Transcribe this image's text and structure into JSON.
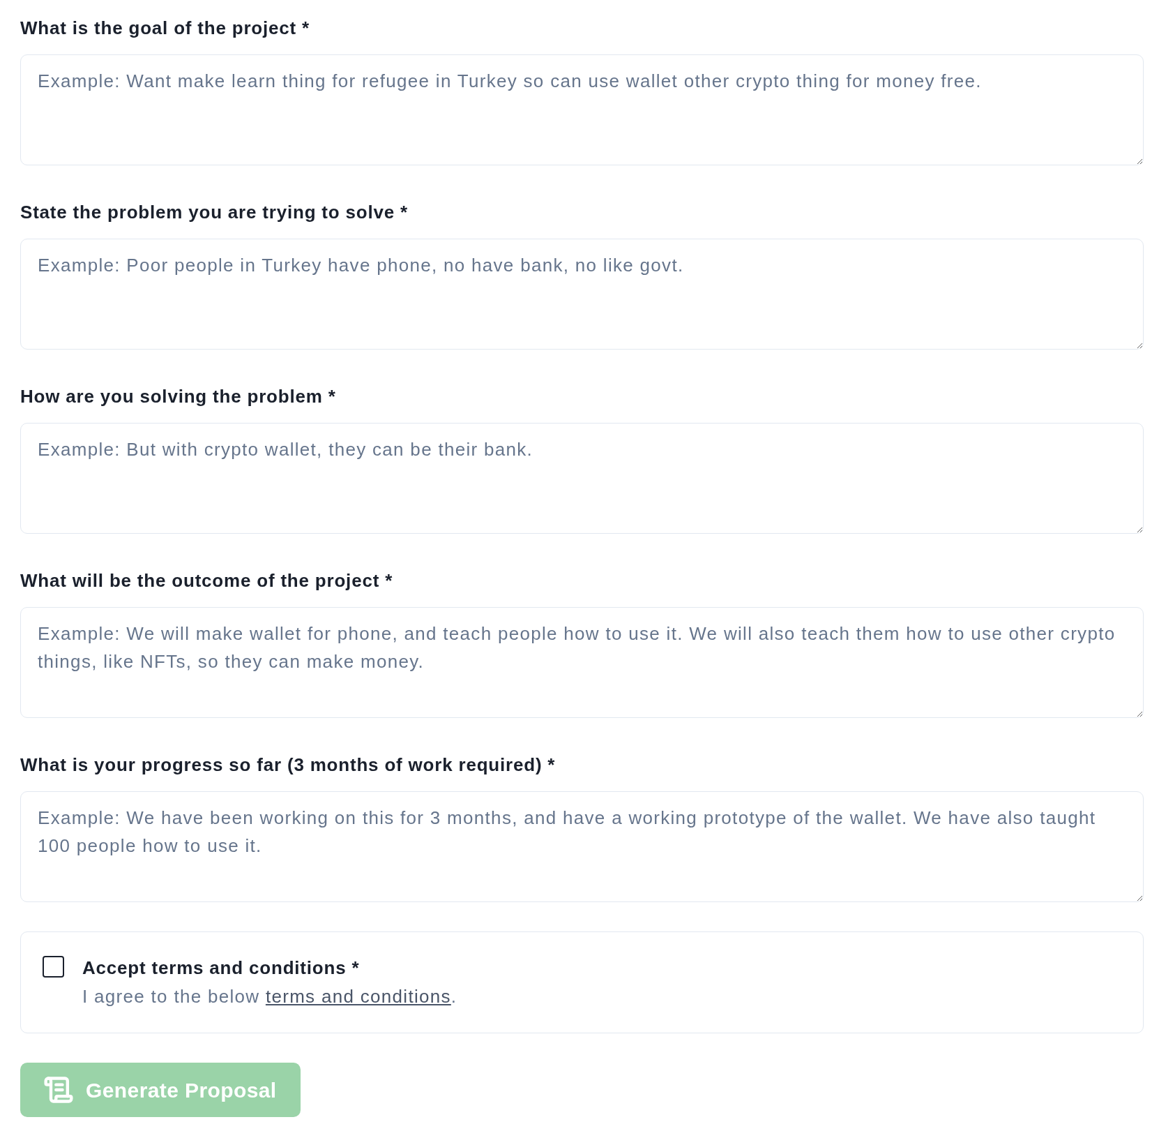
{
  "fields": [
    {
      "label": "What is the goal of the project *",
      "placeholder": "Example: Want make learn thing for refugee in Turkey so can use wallet other crypto thing for money free."
    },
    {
      "label": "State the problem you are trying to solve *",
      "placeholder": "Example: Poor people in Turkey have phone, no have bank, no like govt."
    },
    {
      "label": "How are you solving the problem *",
      "placeholder": "Example: But with crypto wallet, they can be their bank."
    },
    {
      "label": "What will be the outcome of the project *",
      "placeholder": "Example: We will make wallet for phone, and teach people how to use it. We will also teach them how to use other crypto things, like NFTs, so they can make money."
    },
    {
      "label": "What is your progress so far (3 months of work required) *",
      "placeholder": "Example: We have been working on this for 3 months, and have a working prototype of the wallet. We have also taught 100 people how to use it."
    }
  ],
  "terms": {
    "checked": false,
    "title": "Accept terms and conditions *",
    "text_before": "I agree to the below ",
    "link": "terms and conditions",
    "text_after": "."
  },
  "submit": {
    "label": "Generate Proposal",
    "disabled": true
  }
}
